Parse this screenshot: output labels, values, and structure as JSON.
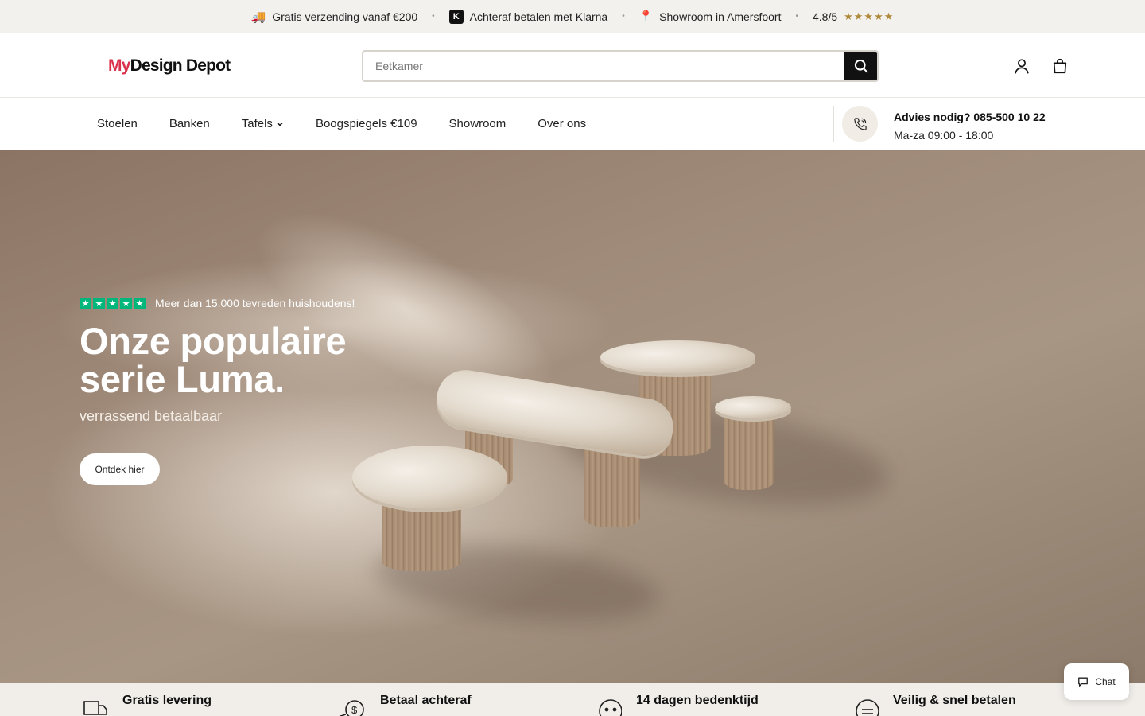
{
  "topbar": {
    "shipping": "Gratis verzending vanaf €200",
    "klarna_badge": "K",
    "klarna": "Achteraf betalen met Klarna",
    "showroom": "Showroom in Amersfoort",
    "rating": "4.8/5",
    "rating_stars": "★★★★★"
  },
  "header": {
    "logo_my": "My",
    "logo_rest": "Design Depot",
    "search_placeholder": "Eetkamer"
  },
  "nav": {
    "items": [
      "Stoelen",
      "Banken",
      "Tafels",
      "Boogspiegels €109",
      "Showroom",
      "Over ons"
    ],
    "advice_title": "Advies nodig? 085-500 10 22",
    "advice_hours": "Ma-za 09:00 - 18:00"
  },
  "hero": {
    "trust_text": "Meer dan 15.000 tevreden huishoudens!",
    "title_line1": "Onze populaire",
    "title_line2": "serie Luma.",
    "subtitle": "verrassend betaalbaar",
    "cta": "Ontdek hier"
  },
  "usps": [
    "Gratis levering",
    "Betaal achteraf",
    "14 dagen bedenktijd",
    "Veilig & snel betalen"
  ],
  "chat": {
    "label": "Chat"
  },
  "colors": {
    "accent": "#d9314c",
    "trustpilot": "#00b67a",
    "dark": "#111111"
  }
}
